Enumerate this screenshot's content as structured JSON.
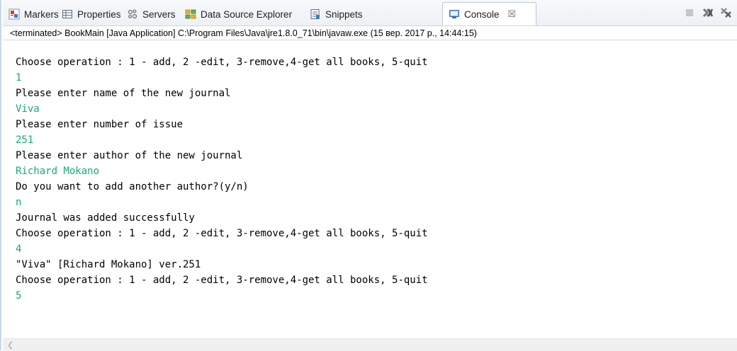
{
  "tabs": [
    {
      "label": "Markers",
      "icon": "markers-icon",
      "active": false
    },
    {
      "label": "Properties",
      "icon": "properties-icon",
      "active": false
    },
    {
      "label": "Servers",
      "icon": "servers-icon",
      "active": false
    },
    {
      "label": "Data Source Explorer",
      "icon": "data-source-explorer-icon",
      "active": false
    },
    {
      "label": "Snippets",
      "icon": "snippets-icon",
      "active": false
    },
    {
      "label": "Console",
      "icon": "console-icon",
      "active": true,
      "close": "☒"
    }
  ],
  "view_actions": [
    "terminate-icon",
    "remove-launch-icon",
    "remove-all-terminated-icon"
  ],
  "status_line": "<terminated> BookMain [Java Application] C:\\Program Files\\Java\\jre1.8.0_71\\bin\\javaw.exe (15 вер. 2017 р., 14:44:15)",
  "console": {
    "lines": [
      {
        "text": "Choose operation : 1 - add, 2 -edit, 3-remove,4-get all books, 5-quit",
        "kind": "out"
      },
      {
        "text": "1",
        "kind": "in"
      },
      {
        "text": "Please enter name of the new journal",
        "kind": "out"
      },
      {
        "text": "Viva",
        "kind": "in"
      },
      {
        "text": "Please enter number of issue",
        "kind": "out"
      },
      {
        "text": "251",
        "kind": "in"
      },
      {
        "text": "Please enter author of the new journal",
        "kind": "out"
      },
      {
        "text": "Richard Mokano",
        "kind": "in"
      },
      {
        "text": "Do you want to add another author?(y/n)",
        "kind": "out"
      },
      {
        "text": "n",
        "kind": "in"
      },
      {
        "text": "Journal was added successfully",
        "kind": "out"
      },
      {
        "text": "Choose operation : 1 - add, 2 -edit, 3-remove,4-get all books, 5-quit",
        "kind": "out"
      },
      {
        "text": "4",
        "kind": "in"
      },
      {
        "text": "\"Viva\" [Richard Mokano] ver.251",
        "kind": "out"
      },
      {
        "text": "Choose operation : 1 - add, 2 -edit, 3-remove,4-get all books, 5-quit",
        "kind": "out"
      },
      {
        "text": "5",
        "kind": "in"
      }
    ]
  },
  "colors": {
    "stdin_text": "#1aa877",
    "stdout_text": "#000000",
    "frame_border": "#c9d7e8"
  }
}
